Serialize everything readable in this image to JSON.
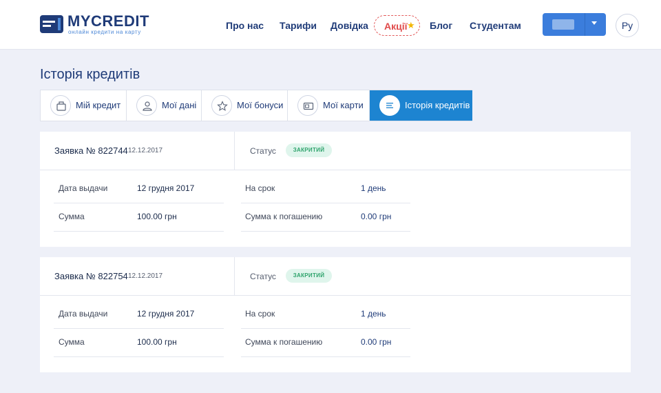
{
  "header": {
    "logo_text": "MYCREDIT",
    "logo_sub": "онлайн кредити на карту",
    "nav": [
      {
        "label": "Про нас"
      },
      {
        "label": "Тарифи"
      },
      {
        "label": "Довідка"
      },
      {
        "label": "Акції"
      },
      {
        "label": "Блог"
      },
      {
        "label": "Студентам"
      }
    ],
    "lang": "Ру"
  },
  "page_title": "Історія кредитів",
  "tabs": [
    {
      "label": "Мій кредит",
      "icon": "wallet-icon",
      "active": false
    },
    {
      "label": "Мої дані",
      "icon": "user-icon",
      "active": false
    },
    {
      "label": "Мої бонуси",
      "icon": "star-icon",
      "active": false
    },
    {
      "label": "Мої карти",
      "icon": "card-icon",
      "active": false
    },
    {
      "label": "Історія кредитів",
      "icon": "list-icon",
      "active": true
    }
  ],
  "applications": [
    {
      "number": "Заявка № 822744",
      "date": "12.12.2017",
      "status_label": "Статус",
      "status": "ЗАКРИТИЙ",
      "issue_date_label": "Дата выдачи",
      "issue_date": "12 грудня 2017",
      "amount_label": "Сумма",
      "amount": "100.00 грн",
      "term_label": "На срок",
      "term": "1 день",
      "repay_label": "Сумма к погашению",
      "repay": "0.00 грн"
    },
    {
      "number": "Заявка № 822754",
      "date": "12.12.2017",
      "status_label": "Статус",
      "status": "ЗАКРИТИЙ",
      "issue_date_label": "Дата выдачи",
      "issue_date": "12 грудня 2017",
      "amount_label": "Сумма",
      "amount": "100.00 грн",
      "term_label": "На срок",
      "term": "1 день",
      "repay_label": "Сумма к погашению",
      "repay": "0.00 грн"
    }
  ],
  "colors": {
    "brand": "#1f3b78",
    "accent": "#1d84d1",
    "promo": "#e04a4a",
    "status_green": "#2ea36c",
    "background": "#eef0f8"
  }
}
